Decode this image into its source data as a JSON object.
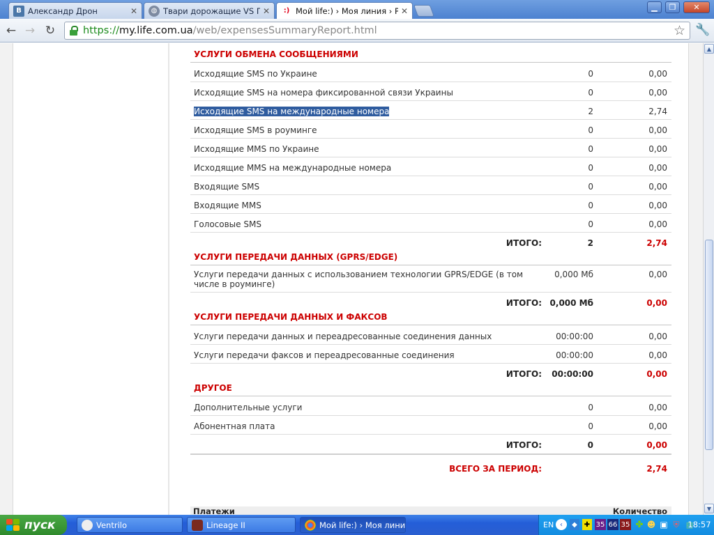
{
  "browser": {
    "tabs": [
      {
        "title": "Александр Дрон",
        "favicon": "vk-icon",
        "favicon_letter": "B",
        "active": false
      },
      {
        "title": "Твари дорожащие VS Право и",
        "favicon": "globe-icon",
        "active": false
      },
      {
        "title": "Мой life:) › Моя линия › Расхс",
        "favicon": "life-icon",
        "favicon_letter": ":)",
        "active": true
      }
    ],
    "url": {
      "scheme": "https://",
      "host": "my.life.com.ua",
      "path": "/web/expensesSummaryReport.html"
    }
  },
  "report": {
    "sections": [
      {
        "title": "УСЛУГИ ОБМЕНА СООБЩЕНИЯМИ",
        "rows": [
          {
            "name": "Исходящие SMS по Украине",
            "qty": "0",
            "cost": "0,00"
          },
          {
            "name": "Исходящие SMS на номера фиксированной связи Украины",
            "qty": "0",
            "cost": "0,00"
          },
          {
            "name": "Исходящие SMS на международные номера",
            "qty": "2",
            "cost": "2,74",
            "selected": true
          },
          {
            "name": "Исходящие SMS в роуминге",
            "qty": "0",
            "cost": "0,00"
          },
          {
            "name": "Исходящие MMS по Украине",
            "qty": "0",
            "cost": "0,00"
          },
          {
            "name": "Исходящие MMS на международные номера",
            "qty": "0",
            "cost": "0,00"
          },
          {
            "name": "Входящие SMS",
            "qty": "0",
            "cost": "0,00"
          },
          {
            "name": "Входящие MMS",
            "qty": "0",
            "cost": "0,00"
          },
          {
            "name": "Голосовые SMS",
            "qty": "0",
            "cost": "0,00"
          }
        ],
        "total": {
          "label": "ИТОГО:",
          "qty": "2",
          "cost": "2,74"
        }
      },
      {
        "title": "УСЛУГИ ПЕРЕДАЧИ ДАННЫХ (GPRS/EDGE)",
        "rows": [
          {
            "name": "Услуги передачи данных с использованием технологии GPRS/EDGE (в том числе в роуминге)",
            "qty": "0,000 Мб",
            "cost": "0,00"
          }
        ],
        "total": {
          "label": "ИТОГО:",
          "qty": "0,000 Мб",
          "cost": "0,00"
        }
      },
      {
        "title": "УСЛУГИ ПЕРЕДАЧИ ДАННЫХ И ФАКСОВ",
        "rows": [
          {
            "name": "Услуги передачи данных и переадресованные соединения данных",
            "qty": "00:00:00",
            "cost": "0,00"
          },
          {
            "name": "Услуги передачи факсов и переадресованные соединения",
            "qty": "00:00:00",
            "cost": "0,00"
          }
        ],
        "total": {
          "label": "ИТОГО:",
          "qty": "00:00:00",
          "cost": "0,00"
        }
      },
      {
        "title": "ДРУГОЕ",
        "rows": [
          {
            "name": "Дополнительные услуги",
            "qty": "0",
            "cost": "0,00"
          },
          {
            "name": "Абонентная плата",
            "qty": "0",
            "cost": "0,00"
          }
        ],
        "total": {
          "label": "ИТОГО:",
          "qty": "0",
          "cost": "0,00"
        }
      }
    ],
    "grand_total": {
      "label": "ВСЕГО ЗА ПЕРИОД:",
      "cost": "2,74"
    },
    "payments_header": {
      "col1": "Платежи",
      "col2": "Количество"
    }
  },
  "taskbar": {
    "start_label": "пуск",
    "items": [
      {
        "label": "Ventrilo",
        "icon": "ventrilo-icon",
        "active": false
      },
      {
        "label": "Lineage II",
        "icon": "lineage-icon",
        "active": false
      },
      {
        "label": "Мой life:) › Моя лини...",
        "icon": "chrome-icon",
        "active": true
      }
    ],
    "tray": {
      "lang": "EN",
      "nums": [
        "35",
        "66",
        "35"
      ],
      "clock": "18:57"
    }
  },
  "colors": {
    "accent_red": "#cc0000",
    "selection": "#2f5c9f"
  }
}
